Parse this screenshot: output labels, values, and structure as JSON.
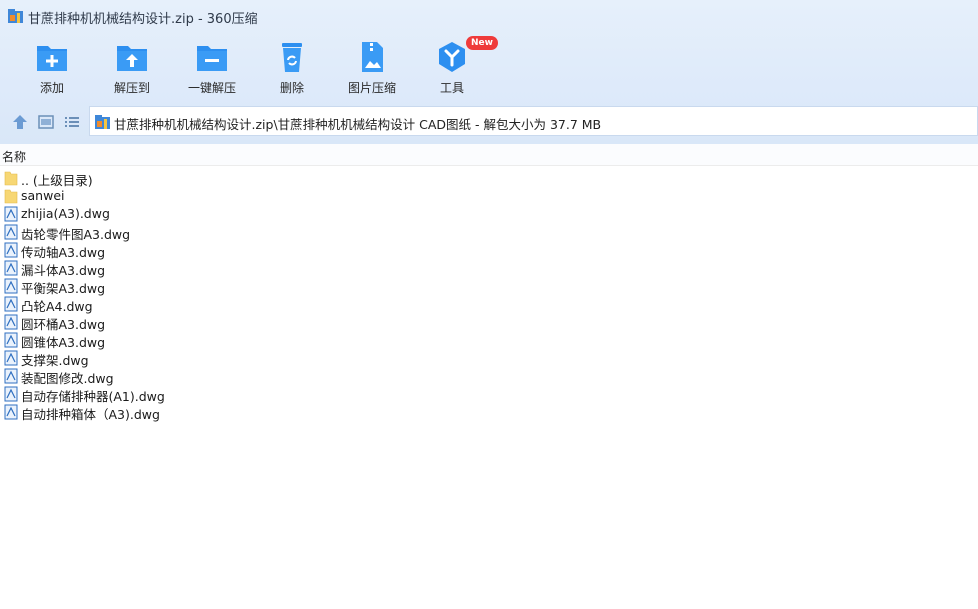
{
  "window": {
    "title": "甘蔗排种机机械结构设计.zip - 360压缩"
  },
  "toolbar": {
    "items": [
      {
        "label": "添加",
        "icon": "add-archive-icon"
      },
      {
        "label": "解压到",
        "icon": "extract-to-icon"
      },
      {
        "label": "一键解压",
        "icon": "one-click-extract-icon"
      },
      {
        "label": "删除",
        "icon": "delete-recycle-icon"
      },
      {
        "label": "图片压缩",
        "icon": "image-compress-icon"
      },
      {
        "label": "工具",
        "icon": "tools-cube-icon",
        "badge": "New"
      }
    ]
  },
  "nav": {
    "up": "up-arrow-icon",
    "view": "view-mode-icon",
    "list": "list-view-icon"
  },
  "path": {
    "text": "甘蔗排种机机械结构设计.zip\\甘蔗排种机机械结构设计 CAD图纸 - 解包大小为 37.7 MB"
  },
  "columns": {
    "name": "名称"
  },
  "files": [
    {
      "name": ".. (上级目录)",
      "type": "folder"
    },
    {
      "name": "sanwei",
      "type": "folder"
    },
    {
      "name": "zhijia(A3).dwg",
      "type": "dwg"
    },
    {
      "name": "齿轮零件图A3.dwg",
      "type": "dwg"
    },
    {
      "name": "传动轴A3.dwg",
      "type": "dwg"
    },
    {
      "name": "漏斗体A3.dwg",
      "type": "dwg"
    },
    {
      "name": "平衡架A3.dwg",
      "type": "dwg"
    },
    {
      "name": "凸轮A4.dwg",
      "type": "dwg"
    },
    {
      "name": "圆环桶A3.dwg",
      "type": "dwg"
    },
    {
      "name": "圆锥体A3.dwg",
      "type": "dwg"
    },
    {
      "name": "支撑架.dwg",
      "type": "dwg"
    },
    {
      "name": "装配图修改.dwg",
      "type": "dwg"
    },
    {
      "name": "自动存储排种器(A1).dwg",
      "type": "dwg"
    },
    {
      "name": "自动排种箱体（A3).dwg",
      "type": "dwg"
    }
  ],
  "colors": {
    "accent": "#2d8ff0",
    "badge": "#ef3b3b",
    "folder": "#f7d774"
  }
}
